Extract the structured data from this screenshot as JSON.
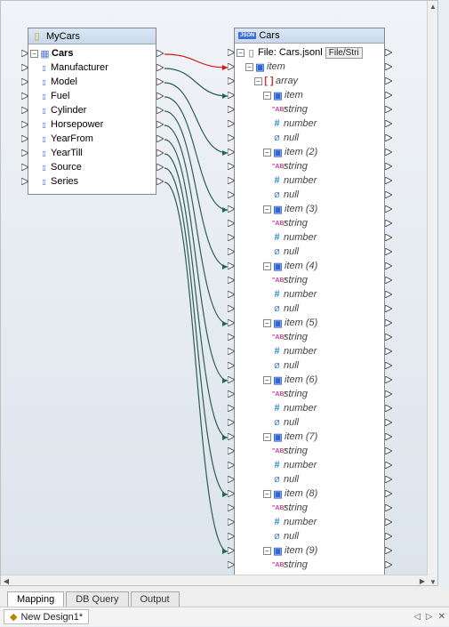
{
  "leftBox": {
    "title": "MyCars",
    "root": "Cars",
    "fields": [
      "Manufacturer",
      "Model",
      "Fuel",
      "Cylinder",
      "Horsepower",
      "YearFrom",
      "YearTill",
      "Source",
      "Series"
    ]
  },
  "rightBox": {
    "title": "Cars",
    "fileLabel": "File: Cars.jsonl",
    "fileBtn": "File/Stri",
    "root": "item",
    "array": "array",
    "itemLabel": "item",
    "items": [
      {
        "label": "item"
      },
      {
        "label": "item (2)"
      },
      {
        "label": "item (3)"
      },
      {
        "label": "item (4)"
      },
      {
        "label": "item (5)"
      },
      {
        "label": "item (6)"
      },
      {
        "label": "item (7)"
      },
      {
        "label": "item (8)"
      },
      {
        "label": "item (9)"
      }
    ],
    "leaf": {
      "string": "string",
      "number": "number",
      "null": "null"
    }
  },
  "tabs": [
    "Mapping",
    "DB Query",
    "Output"
  ],
  "docTab": "New Design1*",
  "colors": {
    "highlight": "#d11"
  }
}
